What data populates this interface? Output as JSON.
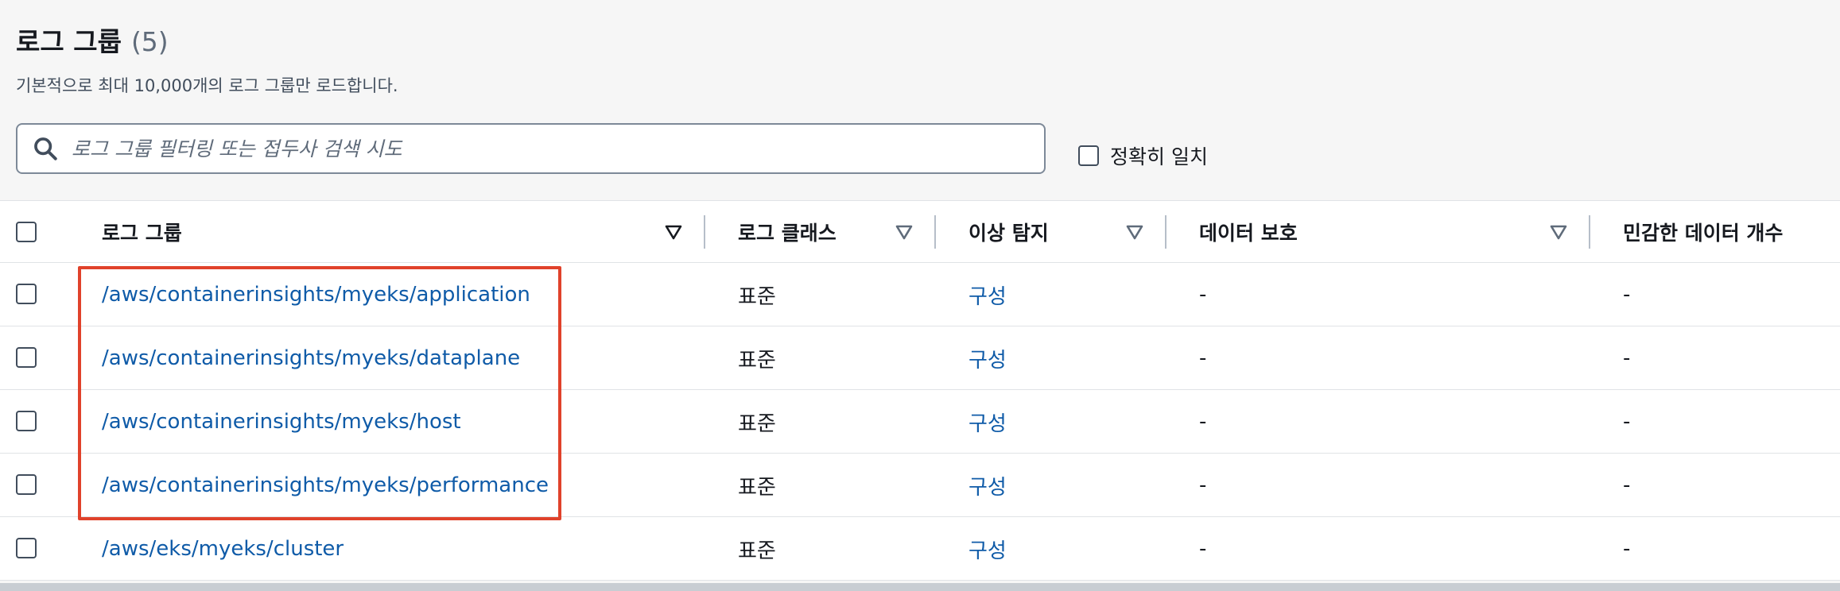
{
  "header": {
    "title": "로그 그룹",
    "count": "(5)",
    "subtitle": "기본적으로 최대 10,000개의 로그 그룹만 로드합니다."
  },
  "search": {
    "placeholder": "로그 그룹 필터링 또는 접두사 검색 시도",
    "value": ""
  },
  "exact_match": {
    "label": "정확히 일치",
    "checked": false
  },
  "table": {
    "columns": [
      {
        "key": "name",
        "label": "로그 그룹"
      },
      {
        "key": "class",
        "label": "로그 클래스"
      },
      {
        "key": "anomaly",
        "label": "이상 탐지"
      },
      {
        "key": "protection",
        "label": "데이터 보호"
      },
      {
        "key": "sensitive",
        "label": "민감한 데이터 개수"
      }
    ],
    "rows": [
      {
        "name": "/aws/containerinsights/myeks/application",
        "class": "표준",
        "anomaly": "구성",
        "protection": "-",
        "sensitive": "-"
      },
      {
        "name": "/aws/containerinsights/myeks/dataplane",
        "class": "표준",
        "anomaly": "구성",
        "protection": "-",
        "sensitive": "-"
      },
      {
        "name": "/aws/containerinsights/myeks/host",
        "class": "표준",
        "anomaly": "구성",
        "protection": "-",
        "sensitive": "-"
      },
      {
        "name": "/aws/containerinsights/myeks/performance",
        "class": "표준",
        "anomaly": "구성",
        "protection": "-",
        "sensitive": "-"
      },
      {
        "name": "/aws/eks/myeks/cluster",
        "class": "표준",
        "anomaly": "구성",
        "protection": "-",
        "sensitive": "-"
      }
    ]
  },
  "colors": {
    "link": "#0f5ba8",
    "highlight": "#e0422b"
  }
}
